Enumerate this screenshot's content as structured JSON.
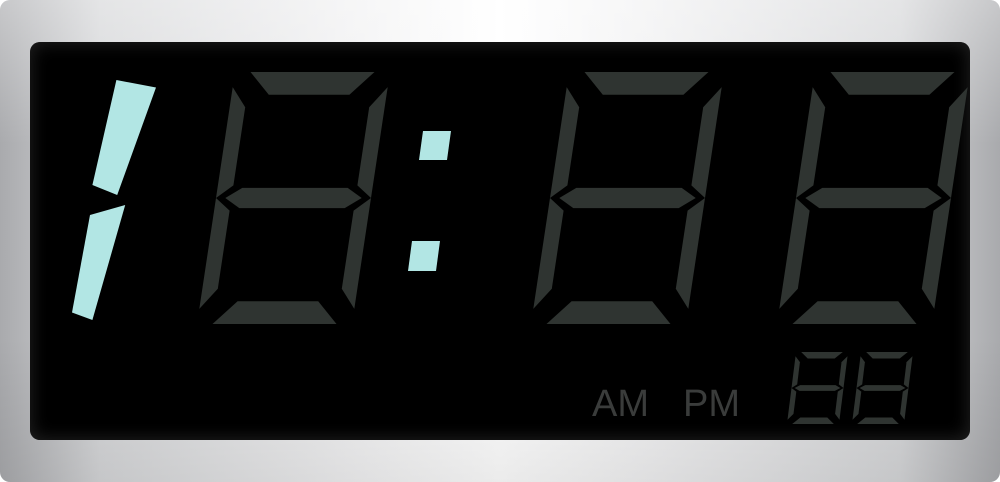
{
  "clock": {
    "digits": [
      {
        "name": "hour-tens",
        "lit": "1"
      },
      {
        "name": "hour-ones",
        "lit": ""
      },
      {
        "name": "minute-tens",
        "lit": ""
      },
      {
        "name": "minute-ones",
        "lit": ""
      },
      {
        "name": "second-tens",
        "lit": ""
      },
      {
        "name": "second-ones",
        "lit": ""
      }
    ],
    "colon_lit": true,
    "am_label": "AM",
    "pm_label": "PM",
    "lit_color": "#b2e6e4",
    "unlit_color": "#2f3431",
    "screen_color": "#000000",
    "bezel_color": "#d6d7d9"
  }
}
